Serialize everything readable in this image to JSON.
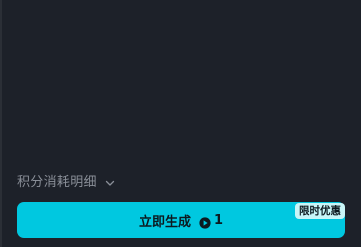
{
  "credits": {
    "toggle_label": "积分消耗明细",
    "chevron_icon": "chevron-down-icon"
  },
  "generate_button": {
    "label": "立即生成",
    "cost_icon": "credit-coin-icon",
    "cost_value": "1",
    "promo_badge": "限时优惠"
  },
  "colors": {
    "background": "#1d2129",
    "accent": "#00c8e0",
    "badge_bg": "#c9f5f7",
    "muted_text": "#8a8f98"
  }
}
